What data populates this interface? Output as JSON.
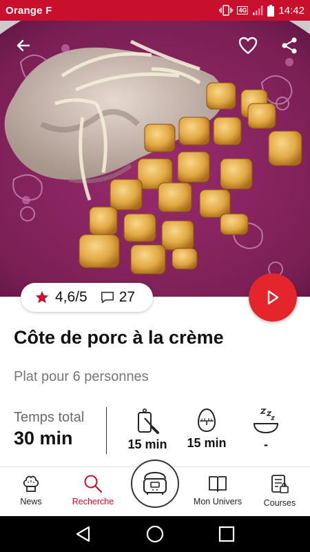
{
  "status_bar": {
    "carrier": "Orange F",
    "network": "4G",
    "time": "14:42"
  },
  "recipe": {
    "rating": "4,6/5",
    "comments": "27",
    "title": "Côte de porc à la crème",
    "servings": "Plat pour 6 personnes",
    "total_time_label": "Temps total",
    "total_time": "30 min",
    "prep_time": "15 min",
    "cook_time": "15 min",
    "rest_time": "-"
  },
  "icons": {
    "back": "arrow-left-icon",
    "favorite": "heart-icon",
    "share": "share-icon",
    "play": "play-icon",
    "star": "star-icon",
    "comment": "comment-icon",
    "prep": "knife-board-icon",
    "cook": "egg-timer-icon",
    "rest": "sleep-bowl-icon"
  },
  "bottom_nav": {
    "items": [
      {
        "label": "News",
        "icon": "chef-hat-icon"
      },
      {
        "label": "Recherche",
        "icon": "search-icon"
      },
      {
        "label": "",
        "icon": "cooker-icon"
      },
      {
        "label": "Mon Univers",
        "icon": "book-icon"
      },
      {
        "label": "Courses",
        "icon": "shopping-list-icon"
      }
    ]
  },
  "colors": {
    "brand_red": "#c8102e",
    "play_red": "#e4262c",
    "plate_purple": "#7a1f55"
  }
}
